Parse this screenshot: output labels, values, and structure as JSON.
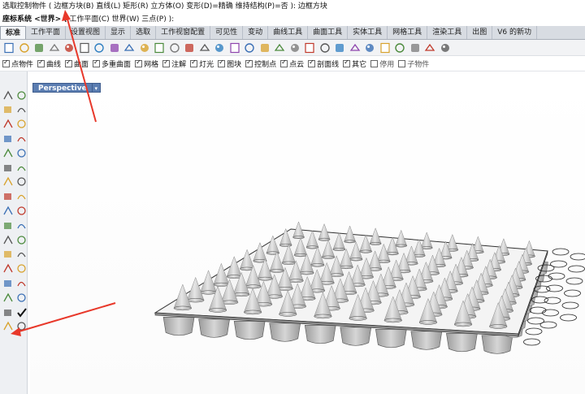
{
  "command": {
    "line1": "选取控制物件 ( 边框方块(B)  直线(L)  矩形(R)  立方体(O)  变形(D)=精确  维持结构(P)=否 ): 边框方块",
    "line2_prefix": "座标系统 <世界> (",
    "line2_rest": " 工作平面(C)  世界(W)  三点(P) ):"
  },
  "tabs": [
    "标准",
    "工作平面",
    "设置视图",
    "显示",
    "选取",
    "工作视窗配置",
    "可见性",
    "变动",
    "曲线工具",
    "曲面工具",
    "实体工具",
    "网格工具",
    "渲染工具",
    "出图",
    "V6 的新功"
  ],
  "active_tab": "标准",
  "toolbar_icons": [
    "new-icon",
    "open-icon",
    "save-icon",
    "print-icon",
    "import-icon",
    "cut-icon",
    "copy-icon",
    "paste-icon",
    "undo-icon",
    "pan-icon",
    "rotate-view-icon",
    "zoom-icon",
    "zoom-window-icon",
    "zoom-extents-icon",
    "zoom-selected-icon",
    "four-viewports-icon",
    "car-icon",
    "hide-icon",
    "lock-icon",
    "cplane-icon",
    "light-icon",
    "layer-icon",
    "color-wheel-icon",
    "render-icon",
    "material-icon",
    "environment-icon",
    "sun-icon",
    "texture-icon",
    "options-icon",
    "help-icon"
  ],
  "filters": [
    {
      "label": "点物件",
      "checked": true
    },
    {
      "label": "曲线",
      "checked": true
    },
    {
      "label": "曲面",
      "checked": true
    },
    {
      "label": "多重曲面",
      "checked": true
    },
    {
      "label": "网格",
      "checked": true
    },
    {
      "label": "注解",
      "checked": true
    },
    {
      "label": "灯光",
      "checked": true
    },
    {
      "label": "图块",
      "checked": true
    },
    {
      "label": "控制点",
      "checked": true
    },
    {
      "label": "点云",
      "checked": true
    },
    {
      "label": "剖面线",
      "checked": true
    },
    {
      "label": "其它",
      "checked": true
    },
    {
      "label": "停用",
      "checked": false
    },
    {
      "label": "子物件",
      "checked": false
    }
  ],
  "viewport": {
    "title": "Perspective",
    "dropdown": "▾"
  },
  "accent_colors": {
    "viewport_tab": "#5b7db1",
    "arrow": "#e8382a",
    "surface_shade": "#c8c8c8"
  }
}
